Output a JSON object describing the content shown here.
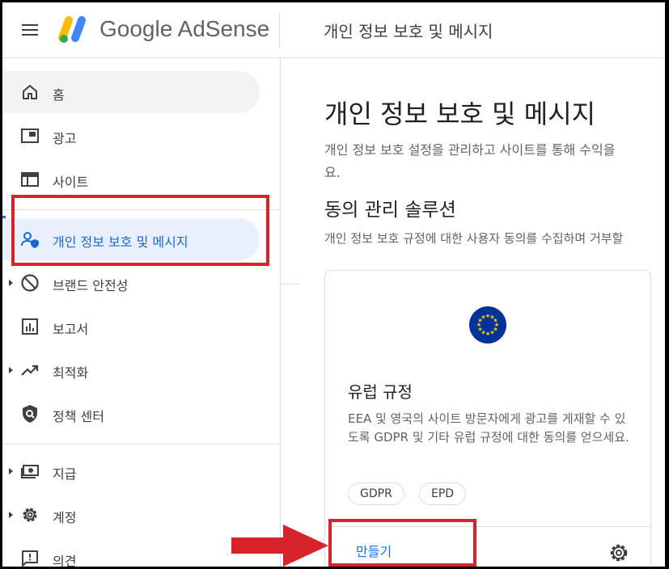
{
  "header": {
    "brand": "Google AdSense",
    "title": "개인 정보 보호 및 메시지"
  },
  "sidebar": {
    "items": [
      {
        "label": "홈",
        "icon": "home-icon"
      },
      {
        "label": "광고",
        "icon": "ads-icon"
      },
      {
        "label": "사이트",
        "icon": "sites-icon"
      },
      {
        "label": "개인 정보 보호 및 메시지",
        "icon": "privacy-icon"
      },
      {
        "label": "브랜드 안전성",
        "icon": "block-icon"
      },
      {
        "label": "보고서",
        "icon": "reports-icon"
      },
      {
        "label": "최적화",
        "icon": "trending-icon"
      },
      {
        "label": "정책 센터",
        "icon": "policy-shield-icon"
      },
      {
        "label": "지급",
        "icon": "payments-icon"
      },
      {
        "label": "계정",
        "icon": "gear-icon"
      },
      {
        "label": "의견",
        "icon": "feedback-icon"
      }
    ]
  },
  "main": {
    "title": "개인 정보 보호 및 메시지",
    "description": "개인 정보 보호 설정을 관리하고 사이트를 통해 수익을\n요.",
    "section_title": "동의 관리 솔루션",
    "section_desc": "개인 정보 보호 규정에 대한 사용자 동의를 수집하며 거부할",
    "card": {
      "title": "유럽 규정",
      "description": "EEA 및 영국의 사이트 방문자에게 광고를 게재할 수 있도록 GDPR 및 기타 유럽 규정에 대한 동의를 얻으세요.",
      "chips": [
        "GDPR",
        "EPD"
      ],
      "create_label": "만들기"
    }
  },
  "colors": {
    "accent": "#1a73e8",
    "active_bg": "#e8f0fe",
    "annotation_red": "#d9232a",
    "eu_blue": "#003399",
    "eu_gold": "#ffcc00"
  }
}
